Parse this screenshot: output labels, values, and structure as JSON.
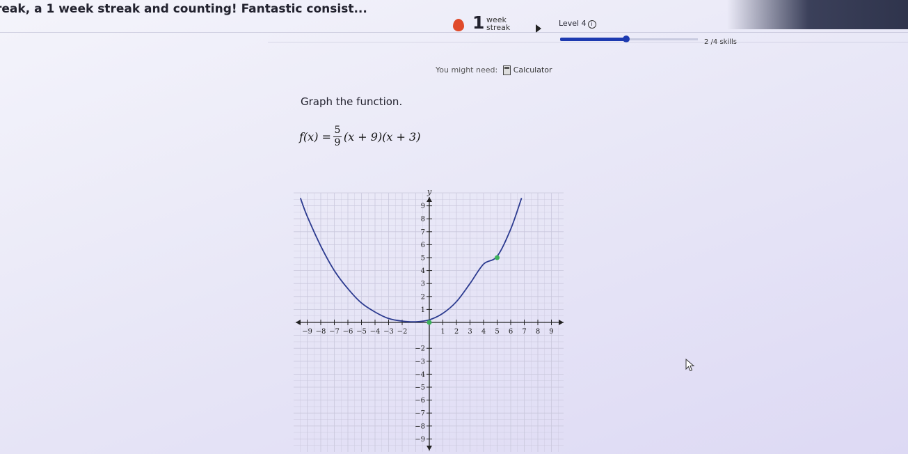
{
  "header": {
    "banner": "reak, a 1 week streak and counting! Fantastic consist...",
    "streak": {
      "number": "1",
      "unit_line1": "week",
      "unit_line2": "streak"
    },
    "level": {
      "label": "Level 4",
      "info_icon": "ⓘ"
    },
    "progress": {
      "fraction": 0.48
    },
    "skills": "2 /4 skills"
  },
  "tools": {
    "need_label": "You might need:",
    "calculator_label": "Calculator"
  },
  "question": {
    "prompt": "Graph the function.",
    "lhs": "f(x) =",
    "frac_num": "5",
    "frac_den": "9",
    "rhs": "(x + 9)(x + 3)"
  },
  "colors": {
    "curve": "#2b3a8f",
    "point": "#3cb15a",
    "progress": "#1d3ab0",
    "flame": "#e04a2a"
  },
  "chart_data": {
    "type": "line",
    "xlabel": "x",
    "ylabel": "y",
    "xlim": [
      -10,
      10
    ],
    "ylim": [
      -10,
      10
    ],
    "x_ticks": [
      -9,
      -8,
      -7,
      -6,
      -5,
      -4,
      -3,
      -2,
      1,
      2,
      3,
      4,
      5,
      6,
      7,
      8,
      9
    ],
    "y_ticks": [
      -9,
      -8,
      -7,
      -6,
      -5,
      -4,
      -3,
      -2,
      1,
      2,
      3,
      4,
      5,
      6,
      7,
      8,
      9
    ],
    "grid": true,
    "curve": {
      "kind": "parabola",
      "x": [
        -9.5,
        -9,
        -8,
        -7,
        -6,
        -5,
        -4,
        -3,
        -2,
        -1,
        0,
        1,
        2,
        3,
        4,
        5,
        6,
        6.8
      ],
      "y": [
        9.6,
        8.2,
        5.9,
        4.0,
        2.6,
        1.5,
        0.8,
        0.3,
        0.1,
        0.05,
        0.2,
        0.7,
        1.6,
        3.0,
        4.5,
        5.1,
        7.2,
        9.6
      ]
    },
    "points": [
      {
        "x": 0,
        "y": 0
      },
      {
        "x": 5,
        "y": 5
      }
    ]
  }
}
